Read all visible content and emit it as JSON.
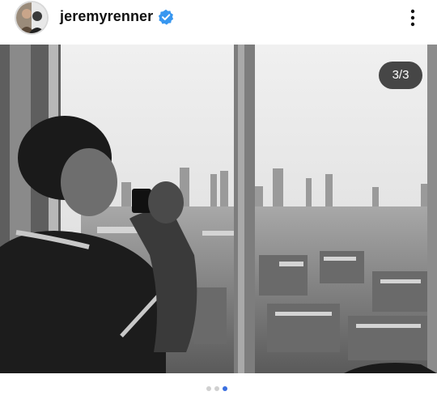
{
  "post": {
    "username": "jeremyrenner",
    "verified": true,
    "avatar_icon": "profile-photo",
    "more_icon": "vertical-ellipsis-icon"
  },
  "carousel": {
    "counter": "3/3",
    "current_index": 3,
    "total": 3,
    "active_dot_color": "#3a6fe0",
    "photo_description_icon": "black-and-white-photo"
  },
  "colors": {
    "verified_badge": "#3897f0",
    "text": "#111111"
  }
}
